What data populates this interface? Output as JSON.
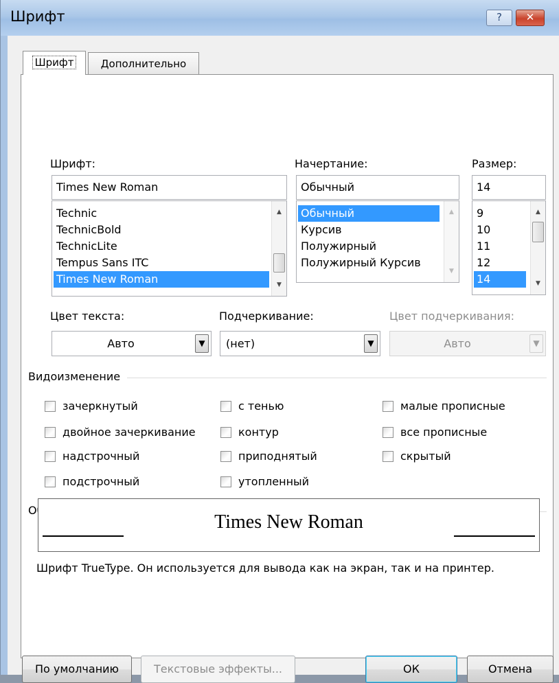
{
  "window": {
    "title": "Шрифт",
    "help_glyph": "?",
    "close_glyph": "✕"
  },
  "tabs": [
    {
      "label": "Шрифт",
      "active": true
    },
    {
      "label": "Дополнительно",
      "active": false
    }
  ],
  "font": {
    "label": "Шрифт:",
    "value": "Times New Roman",
    "items": [
      "Technic",
      "TechnicBold",
      "TechnicLite",
      "Tempus Sans ITC",
      "Times New Roman"
    ],
    "selected_index": 4
  },
  "style": {
    "label": "Начертание:",
    "value": "Обычный",
    "items": [
      "Обычный",
      "Курсив",
      "Полужирный",
      "Полужирный Курсив"
    ],
    "selected_index": 0
  },
  "size": {
    "label": "Размер:",
    "value": "14",
    "items": [
      "9",
      "10",
      "11",
      "12",
      "14"
    ],
    "selected_index": 4
  },
  "text_color": {
    "label": "Цвет текста:",
    "value": "Авто"
  },
  "underline": {
    "label": "Подчеркивание:",
    "value": "(нет)"
  },
  "underline_color": {
    "label": "Цвет подчеркивания:",
    "value": "Авто",
    "disabled": true
  },
  "effects": {
    "title": "Видоизменение",
    "col1": [
      "зачеркнутый",
      "двойное зачеркивание",
      "надстрочный",
      "подстрочный"
    ],
    "col2": [
      "с тенью",
      "контур",
      "приподнятый",
      "утопленный"
    ],
    "col3": [
      "малые прописные",
      "все прописные",
      "скрытый"
    ]
  },
  "sample": {
    "title": "Образец",
    "text": "Times New Roman",
    "description": "Шрифт TrueType. Он используется для вывода как на экран, так и на принтер."
  },
  "buttons": {
    "default": "По умолчанию",
    "text_effects": "Текстовые эффекты...",
    "ok": "ОК",
    "cancel": "Отмена"
  },
  "scroll_glyphs": {
    "up": "▲",
    "down": "▼",
    "dropdown": "▼"
  },
  "colors": {
    "selection": "#3399ff",
    "titlebar": "#aac7e8",
    "close": "#c9432c"
  }
}
